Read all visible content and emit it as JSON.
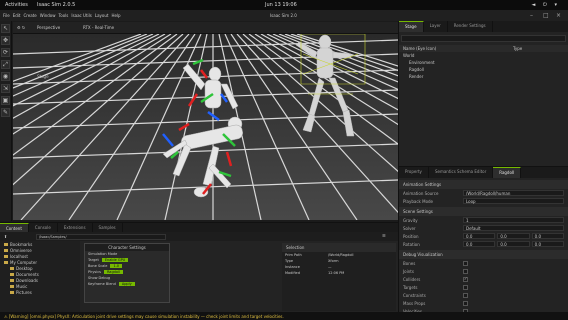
{
  "system": {
    "activities": "Activities",
    "app_name": "Isaac Sim 2.0.5",
    "clock": "Jun 13 19:06",
    "tray": "◄ ⏻ ▾"
  },
  "menubar": {
    "menus": [
      "File",
      "Edit",
      "Create",
      "Window",
      "Tools",
      "Isaac Utils",
      "Layout",
      "Help"
    ],
    "title": "Isaac Sim 2.0"
  },
  "tools": [
    "↖",
    "✥",
    "⟳",
    "⤢",
    "◉",
    "⇲",
    "▣",
    "✎"
  ],
  "viewport": {
    "toolbar_left": "⚙ ↻",
    "camera": "Perspective",
    "render_mode": "RTX - Real-Time",
    "hud": "Stage"
  },
  "stage_panel": {
    "tabs": [
      "Stage",
      "Layer",
      "Render Settings"
    ],
    "active_tab": 0,
    "columns": [
      "Name (Eye Icon)",
      "Type"
    ],
    "items": [
      "World",
      "Environment",
      "Ragdoll",
      "Render"
    ]
  },
  "property_panel": {
    "tabs": [
      "Property",
      "Semantics Schema Editor",
      "Ragdoll"
    ],
    "active_tab": 2,
    "sections": {
      "animation": "Animation Settings",
      "scene": "Scene Settings",
      "debug": "Debug Visualization"
    },
    "rows": [
      {
        "key": "Animation Source",
        "value": "/World/Ragdoll/human"
      },
      {
        "key": "Playback Mode",
        "value": "Loop"
      }
    ],
    "scene_rows": [
      {
        "key": "Gravity",
        "value": "1"
      },
      {
        "key": "Solver",
        "value": "Default"
      }
    ],
    "vec_rows": [
      {
        "key": "Position",
        "values": [
          "0.0",
          "0.0",
          "0.0"
        ]
      },
      {
        "key": "Rotation",
        "values": [
          "0.0",
          "0.0",
          "0.0"
        ]
      }
    ],
    "checks": [
      {
        "label": "Bones",
        "on": false
      },
      {
        "label": "Joints",
        "on": false
      },
      {
        "label": "Colliders",
        "on": true
      },
      {
        "label": "Targets",
        "on": false
      },
      {
        "label": "Constraints",
        "on": false
      },
      {
        "label": "Mass Props",
        "on": false
      },
      {
        "label": "Velocities",
        "on": false
      }
    ]
  },
  "bottom": {
    "tabs": [
      "Content",
      "Console",
      "Extensions",
      "Samples"
    ],
    "active_tab": 0,
    "path": "/Isaac/Samples/",
    "folders": [
      "Bookmarks",
      "Omniverse",
      "localhost",
      "My Computer",
      "Desktop",
      "Documents",
      "Downloads",
      "Music",
      "Pictures"
    ],
    "popup": {
      "title": "Character Settings",
      "lines": [
        {
          "label": "Simulation Mode",
          "value": ""
        },
        {
          "label": "Target",
          "value": "Enable GPU"
        },
        {
          "label": "Bone Scale",
          "value": "1.0"
        },
        {
          "label": "Physics",
          "value": "Ragdoll"
        },
        {
          "label": "Show Debug",
          "value": ""
        },
        {
          "label": "Keyframe Blend",
          "value": "Apply"
        }
      ]
    },
    "detail": {
      "title": "Selection",
      "rows": [
        {
          "k": "Prim Path",
          "v": "/World/Ragdoll"
        },
        {
          "k": "Type",
          "v": "Xform"
        },
        {
          "k": "Instance",
          "v": "—"
        },
        {
          "k": "Modified",
          "v": "12:06 PM"
        }
      ]
    }
  },
  "status": {
    "warning": "⚠ [Warning] [omni.physx] PhysX: Articulation joint drive settings may cause simulation instability — check joint limits and target velocities."
  },
  "colors": {
    "accent": "#76b900",
    "viewport_bg": "#3d3d3d",
    "panel_bg": "#232323"
  }
}
